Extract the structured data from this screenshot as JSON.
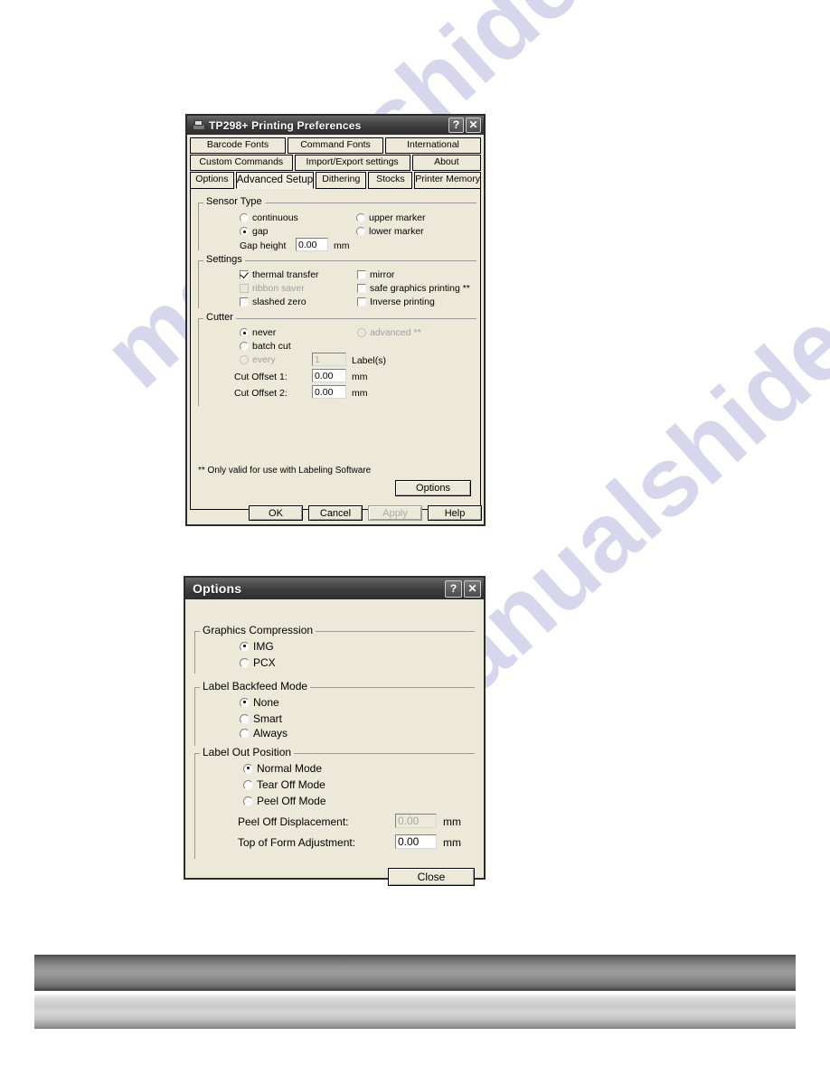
{
  "watermark": {
    "line1": "manualshide.com",
    "line2": "manualshide.com"
  },
  "printing_preferences": {
    "title": "TP298+ Printing Preferences",
    "icon": "printer-icon",
    "help_button": "?",
    "close_button": "✕",
    "tabs_row1": [
      {
        "label": "Barcode Fonts",
        "selected": false
      },
      {
        "label": "Command Fonts",
        "selected": false
      },
      {
        "label": "International",
        "selected": false
      }
    ],
    "tabs_row2": [
      {
        "label": "Custom Commands",
        "selected": false
      },
      {
        "label": "Import/Export settings",
        "selected": false
      },
      {
        "label": "About",
        "selected": false
      }
    ],
    "tabs_row3": [
      {
        "label": "Options",
        "selected": false
      },
      {
        "label": "Advanced Setup",
        "selected": true
      },
      {
        "label": "Dithering",
        "selected": false
      },
      {
        "label": "Stocks",
        "selected": false
      },
      {
        "label": "Printer Memory",
        "selected": false
      }
    ],
    "sensor_type": {
      "legend": "Sensor Type",
      "continuous": {
        "label": "continuous",
        "checked": false
      },
      "gap": {
        "label": "gap",
        "checked": true
      },
      "upper_marker": {
        "label": "upper marker",
        "checked": false
      },
      "lower_marker": {
        "label": "lower marker",
        "checked": false
      },
      "gap_height_label": "Gap height",
      "gap_height_value": "0.00",
      "gap_height_unit": "mm"
    },
    "settings": {
      "legend": "Settings",
      "thermal_transfer": {
        "label": "thermal transfer",
        "checked": true,
        "enabled": true
      },
      "ribbon_saver": {
        "label": "ribbon saver",
        "checked": false,
        "enabled": false
      },
      "slashed_zero": {
        "label": "slashed zero",
        "checked": false,
        "enabled": true
      },
      "mirror": {
        "label": "mirror",
        "checked": false,
        "enabled": true
      },
      "safe_graphics_printing": {
        "label": "safe graphics printing **",
        "checked": false,
        "enabled": true
      },
      "inverse_printing": {
        "label": "Inverse printing",
        "checked": false,
        "enabled": true
      }
    },
    "cutter": {
      "legend": "Cutter",
      "never": {
        "label": "never",
        "checked": true,
        "enabled": true
      },
      "batch_cut": {
        "label": "batch cut",
        "checked": false,
        "enabled": true
      },
      "every": {
        "label": "every",
        "checked": false,
        "enabled": false
      },
      "advanced": {
        "label": "advanced **",
        "checked": false,
        "enabled": false
      },
      "every_value": "1",
      "every_unit": "Label(s)",
      "cut_offset_1_label": "Cut Offset 1:",
      "cut_offset_1_value": "0.00",
      "cut_offset_1_unit": "mm",
      "cut_offset_2_label": "Cut Offset 2:",
      "cut_offset_2_value": "0.00",
      "cut_offset_2_unit": "mm"
    },
    "footnote": "** Only valid for use with Labeling Software",
    "options_button": "Options",
    "buttons": {
      "ok": "OK",
      "cancel": "Cancel",
      "apply": "Apply",
      "help": "Help"
    }
  },
  "options_dialog": {
    "title": "Options",
    "help_button": "?",
    "close_button": "✕",
    "graphics_compression": {
      "legend": "Graphics Compression",
      "img": {
        "label": "IMG",
        "checked": true
      },
      "pcx": {
        "label": "PCX",
        "checked": false
      }
    },
    "label_backfeed_mode": {
      "legend": "Label Backfeed Mode",
      "none": {
        "label": "None",
        "checked": true
      },
      "smart": {
        "label": "Smart",
        "checked": false
      },
      "always": {
        "label": "Always",
        "checked": false
      }
    },
    "label_out_position": {
      "legend": "Label Out Position",
      "normal": {
        "label": "Normal Mode",
        "checked": true
      },
      "tear_off": {
        "label": "Tear Off Mode",
        "checked": false
      },
      "peel_off": {
        "label": "Peel Off Mode",
        "checked": false
      },
      "peel_off_displacement_label": "Peel Off Displacement:",
      "peel_off_displacement_value": "0.00",
      "peel_off_displacement_unit": "mm",
      "top_of_form_label": "Top of Form Adjustment:",
      "top_of_form_value": "0.00",
      "top_of_form_unit": "mm"
    },
    "close_label": "Close"
  }
}
